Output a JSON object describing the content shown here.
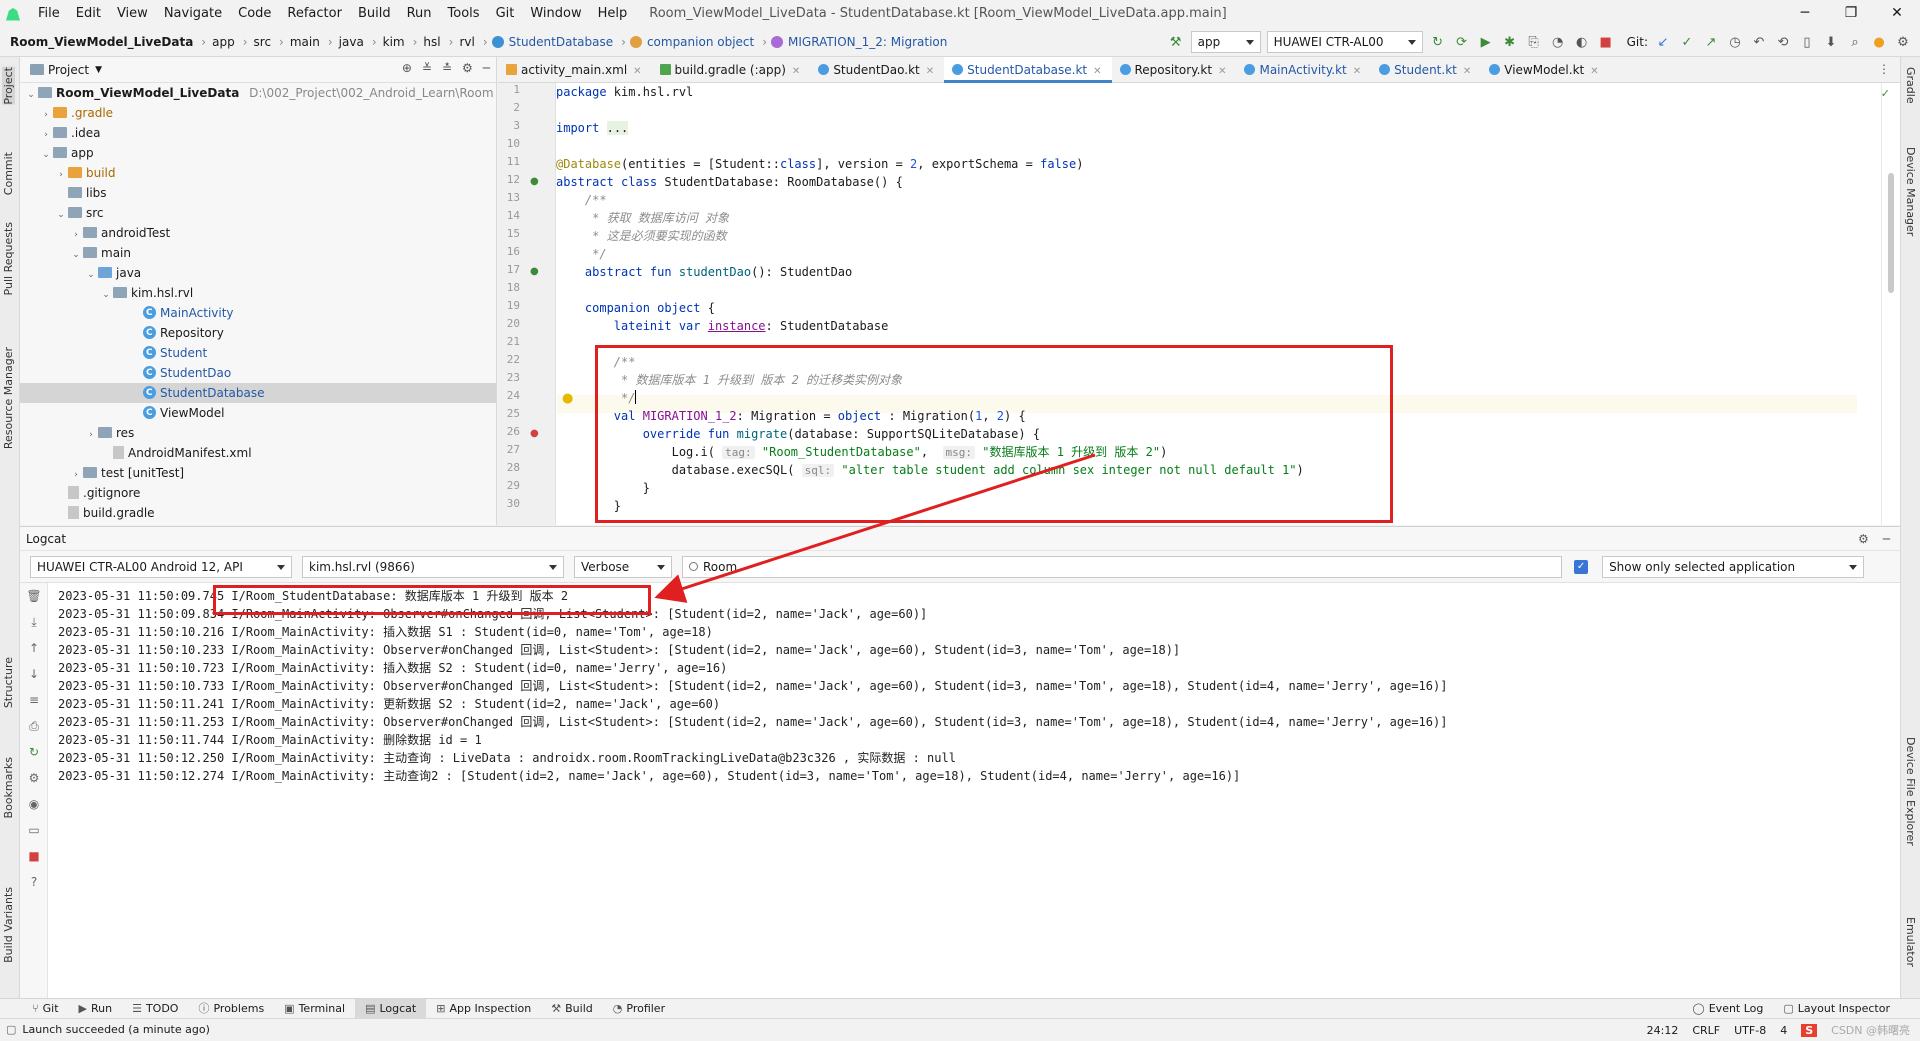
{
  "menu": {
    "items": [
      "File",
      "Edit",
      "View",
      "Navigate",
      "Code",
      "Refactor",
      "Build",
      "Run",
      "Tools",
      "Git",
      "Window",
      "Help"
    ],
    "window_title": "Room_ViewModel_LiveData - StudentDatabase.kt [Room_ViewModel_LiveData.app.main]"
  },
  "breadcrumb": [
    "Room_ViewModel_LiveData",
    "app",
    "src",
    "main",
    "java",
    "kim",
    "hsl",
    "rvl",
    "StudentDatabase",
    "companion object",
    "MIGRATION_1_2: Migration"
  ],
  "toolbar": {
    "run_config": "app",
    "device": "HUAWEI CTR-AL00",
    "git_label": "Git:"
  },
  "project": {
    "title": "Project",
    "root": "Room_ViewModel_LiveData",
    "root_path": "D:\\002_Project\\002_Android_Learn\\Room",
    "tree": [
      {
        "label": ".gradle",
        "indent": 1,
        "arrow": "›",
        "kind": "folder-orange"
      },
      {
        "label": ".idea",
        "indent": 1,
        "arrow": "›",
        "kind": "folder"
      },
      {
        "label": "app",
        "indent": 1,
        "arrow": "⌄",
        "kind": "folder"
      },
      {
        "label": "build",
        "indent": 2,
        "arrow": "›",
        "kind": "folder-orange"
      },
      {
        "label": "libs",
        "indent": 2,
        "arrow": "",
        "kind": "folder"
      },
      {
        "label": "src",
        "indent": 2,
        "arrow": "⌄",
        "kind": "folder"
      },
      {
        "label": "androidTest",
        "indent": 3,
        "arrow": "›",
        "kind": "folder"
      },
      {
        "label": "main",
        "indent": 3,
        "arrow": "⌄",
        "kind": "folder"
      },
      {
        "label": "java",
        "indent": 4,
        "arrow": "⌄",
        "kind": "folder-blue"
      },
      {
        "label": "kim.hsl.rvl",
        "indent": 5,
        "arrow": "⌄",
        "kind": "folder"
      },
      {
        "label": "MainActivity",
        "indent": 7,
        "arrow": "",
        "kind": "class",
        "blue": true
      },
      {
        "label": "Repository",
        "indent": 7,
        "arrow": "",
        "kind": "class"
      },
      {
        "label": "Student",
        "indent": 7,
        "arrow": "",
        "kind": "class",
        "blue": true
      },
      {
        "label": "StudentDao",
        "indent": 7,
        "arrow": "",
        "kind": "class",
        "blue": true
      },
      {
        "label": "StudentDatabase",
        "indent": 7,
        "arrow": "",
        "kind": "class",
        "blue": true,
        "selected": true
      },
      {
        "label": "ViewModel",
        "indent": 7,
        "arrow": "",
        "kind": "class"
      },
      {
        "label": "res",
        "indent": 4,
        "arrow": "›",
        "kind": "folder"
      },
      {
        "label": "AndroidManifest.xml",
        "indent": 5,
        "arrow": "",
        "kind": "file"
      },
      {
        "label": "test [unitTest]",
        "indent": 3,
        "arrow": "›",
        "kind": "folder"
      },
      {
        "label": ".gitignore",
        "indent": 2,
        "arrow": "",
        "kind": "file"
      },
      {
        "label": "build.gradle",
        "indent": 2,
        "arrow": "",
        "kind": "file"
      }
    ]
  },
  "editor_tabs": [
    "activity_main.xml",
    "build.gradle (:app)",
    "StudentDao.kt",
    "StudentDatabase.kt",
    "Repository.kt",
    "MainActivity.kt",
    "Student.kt",
    "ViewModel.kt"
  ],
  "active_tab": "StudentDatabase.kt",
  "code": {
    "line_numbers": [
      "1",
      "2",
      "3",
      "10",
      "11",
      "12",
      "13",
      "14",
      "15",
      "16",
      "17",
      "18",
      "19",
      "20",
      "21",
      "22",
      "23",
      "24",
      "25",
      "26",
      "27",
      "28",
      "29",
      "30"
    ]
  },
  "logcat": {
    "title": "Logcat",
    "device": "HUAWEI CTR-AL00 Android 12, API",
    "process": "kim.hsl.rvl (9866)",
    "level": "Verbose",
    "search": "Room",
    "filter": "Show only selected application",
    "lines": [
      "2023-05-31 11:50:09.745 I/Room_StudentDatabase: 数据库版本 1 升级到 版本 2",
      "2023-05-31 11:50:09.834 I/Room_MainActivity: Observer#onChanged 回调, List<Student>: [Student(id=2, name='Jack', age=60)]",
      "2023-05-31 11:50:10.216 I/Room_MainActivity: 插入数据 S1 : Student(id=0, name='Tom', age=18)",
      "2023-05-31 11:50:10.233 I/Room_MainActivity: Observer#onChanged 回调, List<Student>: [Student(id=2, name='Jack', age=60), Student(id=3, name='Tom', age=18)]",
      "2023-05-31 11:50:10.723 I/Room_MainActivity: 插入数据 S2 : Student(id=0, name='Jerry', age=16)",
      "2023-05-31 11:50:10.733 I/Room_MainActivity: Observer#onChanged 回调, List<Student>: [Student(id=2, name='Jack', age=60), Student(id=3, name='Tom', age=18), Student(id=4, name='Jerry', age=16)]",
      "2023-05-31 11:50:11.241 I/Room_MainActivity: 更新数据 S2 : Student(id=2, name='Jack', age=60)",
      "2023-05-31 11:50:11.253 I/Room_MainActivity: Observer#onChanged 回调, List<Student>: [Student(id=2, name='Jack', age=60), Student(id=3, name='Tom', age=18), Student(id=4, name='Jerry', age=16)]",
      "2023-05-31 11:50:11.744 I/Room_MainActivity: 删除数据 id = 1",
      "2023-05-31 11:50:12.250 I/Room_MainActivity: 主动查询 : LiveData : androidx.room.RoomTrackingLiveData@b23c326 , 实际数据 : null",
      "2023-05-31 11:50:12.274 I/Room_MainActivity: 主动查询2 : [Student(id=2, name='Jack', age=60), Student(id=3, name='Tom', age=18), Student(id=4, name='Jerry', age=16)]"
    ]
  },
  "bottom_tabs": [
    "Git",
    "Run",
    "TODO",
    "Problems",
    "Terminal",
    "Logcat",
    "App Inspection",
    "Build",
    "Profiler"
  ],
  "bottom_right_tabs": [
    "Event Log",
    "Layout Inspector"
  ],
  "left_strip": [
    "Project",
    "Commit",
    "Pull Requests",
    "Resource Manager",
    "Structure",
    "Bookmarks",
    "Build Variants"
  ],
  "right_strip": [
    "Gradle",
    "Device Manager",
    "Device File Explorer",
    "Emulator"
  ],
  "status": {
    "message": "Launch succeeded (a minute ago)",
    "position": "24:12",
    "line_sep": "CRLF",
    "encoding": "UTF-8",
    "indent": "4",
    "watermark": "CSDN @韩曙亮"
  },
  "colors": {
    "accent": "#4083c9",
    "highlight_box": "#e02020",
    "keyword": "#0033b3",
    "string": "#067d17"
  }
}
